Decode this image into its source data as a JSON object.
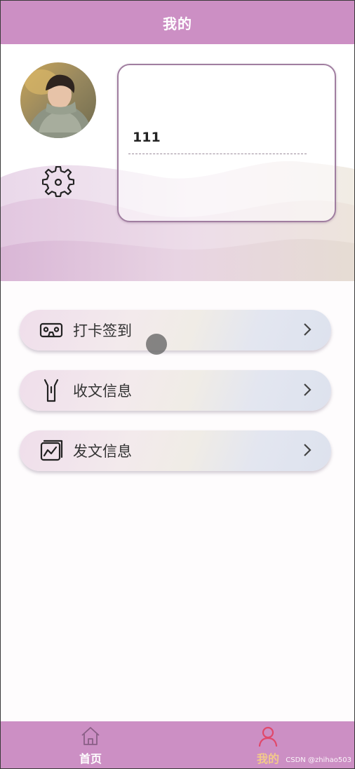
{
  "header": {
    "title": "我的"
  },
  "profile": {
    "info_value": "111"
  },
  "menu": [
    {
      "label": "打卡签到",
      "icon": "vr-headset-icon"
    },
    {
      "label": "收文信息",
      "icon": "inbox-tray-icon"
    },
    {
      "label": "发文信息",
      "icon": "chart-frame-icon"
    }
  ],
  "tabbar": {
    "items": [
      {
        "label": "首页",
        "icon": "home-icon",
        "active": false
      },
      {
        "label": "我的",
        "icon": "user-icon",
        "active": true
      }
    ]
  },
  "watermark": "CSDN @zhihao503",
  "colors": {
    "brand": "#cc8fc4",
    "active_tab_label": "#f2c98a",
    "active_tab_icon": "#e0486a",
    "inactive_tab_label": "#ffffff"
  }
}
